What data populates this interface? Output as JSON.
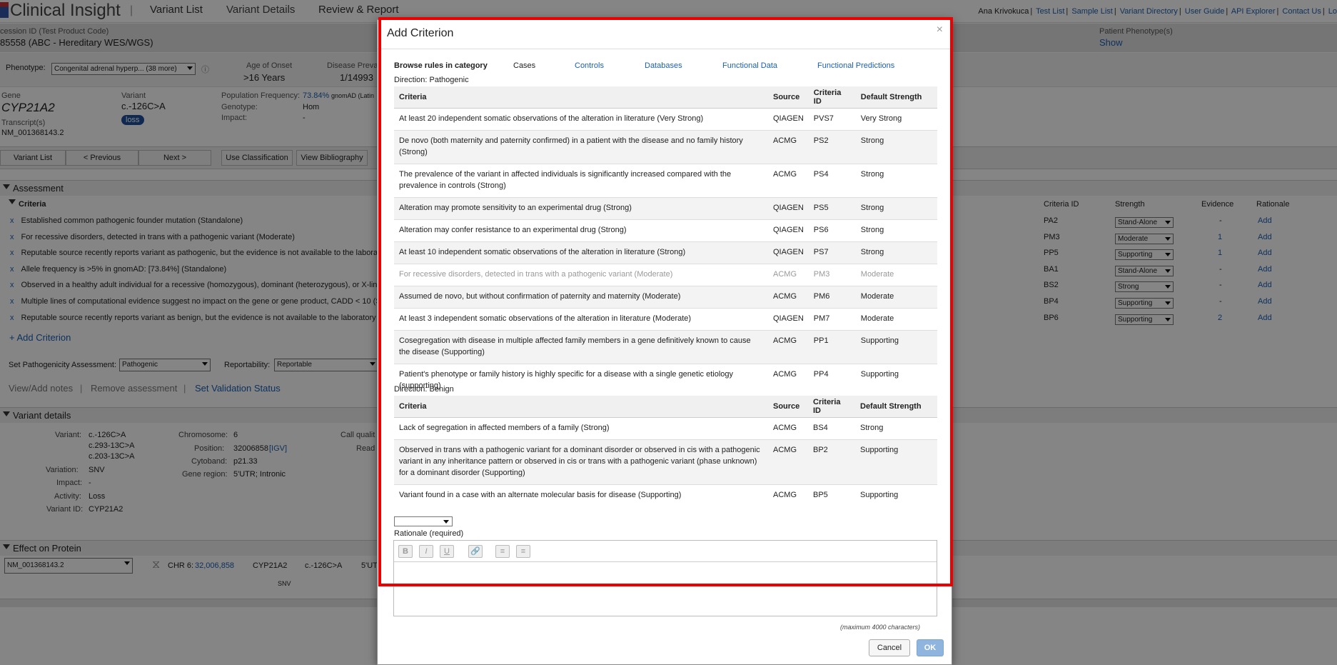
{
  "app": {
    "title": "Clinical Insight",
    "nav": [
      "Variant List",
      "Variant Details",
      "Review & Report"
    ],
    "user": "Ana Krivokuca",
    "links": [
      "Test List",
      "Sample List",
      "Variant Directory",
      "User Guide",
      "API Explorer",
      "Contact Us",
      "Lo"
    ]
  },
  "header": {
    "accession_label": "cession ID (Test Product Code)",
    "accession_value": "85558  (ABC - Hereditary WES/WGS)",
    "patient_pheno_label": "Patient Phenotype(s)",
    "patient_pheno_link": "Show"
  },
  "pheno_row": {
    "label": "Phenotype:",
    "value": "Congenital adrenal hyperp... (38 more)",
    "onset_label": "Age of Onset",
    "onset_value": ">16 Years",
    "prev_label": "Disease Preva",
    "prev_value": "1/14993"
  },
  "gene": {
    "gene_label": "Gene",
    "gene_value": "CYP21A2",
    "transcript_label": "Transcript(s)",
    "transcript_value": "NM_001368143.2",
    "variant_label": "Variant",
    "variant_value": "c.-126C>A",
    "badge": "loss",
    "popfreq_label": "Population Frequency:",
    "popfreq_value": "73.84%",
    "popfreq_src": "gnomAD (Latin",
    "genotype_label": "Genotype:",
    "genotype_value": "Hom",
    "impact_label": "Impact:",
    "impact_value": "-"
  },
  "buttons": [
    "Variant List",
    "< Previous",
    "Next >",
    "Use Classification",
    "View Bibliography"
  ],
  "assessment": {
    "title": "Assessment",
    "criteria_title": "Criteria",
    "cols": [
      "Criteria ID",
      "Strength",
      "Evidence",
      "Rationale"
    ],
    "rows": [
      {
        "text": "Established common pathogenic founder mutation (Standalone)",
        "id": "PA2",
        "strength": "Stand-Alone",
        "evidence": "-",
        "rationale": "Add"
      },
      {
        "text": "For recessive disorders, detected in trans with a pathogenic variant (Moderate)",
        "id": "PM3",
        "strength": "Moderate",
        "evidence": "1",
        "rationale": "Add"
      },
      {
        "text": "Reputable source recently reports variant as pathogenic, but the evidence is not available to the laborat",
        "id": "PP5",
        "strength": "Supporting",
        "evidence": "1",
        "rationale": "Add"
      },
      {
        "text": "Allele frequency is >5% in gnomAD: [73.84%] (Standalone)",
        "id": "BA1",
        "strength": "Stand-Alone",
        "evidence": "-",
        "rationale": "Add"
      },
      {
        "text": "Observed in a healthy adult individual for a recessive (homozygous), dominant (heterozygous), or X-link",
        "id": "BS2",
        "strength": "Strong",
        "evidence": "-",
        "rationale": "Add"
      },
      {
        "text": "Multiple lines of computational evidence suggest no impact on the gene or gene product, CADD < 10 (S",
        "id": "BP4",
        "strength": "Supporting",
        "evidence": "-",
        "rationale": "Add"
      },
      {
        "text": "Reputable source recently reports variant as benign, but the evidence is not available to the laboratory t",
        "id": "BP6",
        "strength": "Supporting",
        "evidence": "2",
        "rationale": "Add"
      }
    ],
    "add_criterion": "+ Add Criterion",
    "set_patho_label": "Set Pathogenicity Assessment:",
    "set_patho_value": "Pathogenic",
    "report_label": "Reportability:",
    "report_value": "Reportable",
    "notes": "View/Add notes",
    "remove": "Remove assessment",
    "validation": "Set Validation Status"
  },
  "variant_details": {
    "title": "Variant details",
    "variant_label": "Variant:",
    "variant_values": [
      "c.-126C>A",
      "c.293-13C>A",
      "c.203-13C>A"
    ],
    "variation_label": "Variation:",
    "variation_value": "SNV",
    "impact_label": "Impact:",
    "impact_value": "-",
    "activity_label": "Activity:",
    "activity_value": "Loss",
    "vid_label": "Variant ID:",
    "vid_value": "CYP21A2",
    "chrom_label": "Chromosome:",
    "chrom_value": "6",
    "pos_label": "Position:",
    "pos_value": "32006858",
    "igv": "[IGV]",
    "cyto_label": "Cytoband:",
    "cyto_value": "p21.33",
    "region_label": "Gene region:",
    "region_value": "5'UTR; Intronic",
    "callq": "Call qualit",
    "read": "Read"
  },
  "effect": {
    "title": "Effect on Protein",
    "transcript": "NM_001368143.2",
    "chr_label": "CHR 6:",
    "chr_value": "32,006,858",
    "gene": "CYP21A2",
    "variant": "c.-126C>A",
    "region": "5'UT",
    "snv": "SNV"
  },
  "dialog": {
    "title": "Add Criterion",
    "close": "×",
    "browse_label": "Browse rules in category",
    "categories": [
      "Cases",
      "Controls",
      "Databases",
      "Functional Data",
      "Functional Predictions"
    ],
    "pathogenic_label": "Direction: ",
    "pathogenic_dir": "Pathogenic",
    "benign_label": "Direction: ",
    "benign_dir": "Benign",
    "headers": [
      "Criteria",
      "Source",
      "Criteria ID",
      "Default Strength"
    ],
    "pathogenic": [
      {
        "c": "At least 20 independent somatic observations of the alteration in literature (Very Strong)",
        "s": "QIAGEN",
        "id": "PVS7",
        "st": "Very Strong"
      },
      {
        "c": "De novo (both maternity and paternity confirmed) in a patient with the disease and no family history (Strong)",
        "s": "ACMG",
        "id": "PS2",
        "st": "Strong"
      },
      {
        "c": "The prevalence of the variant in affected individuals is significantly increased compared with the prevalence in controls (Strong)",
        "s": "ACMG",
        "id": "PS4",
        "st": "Strong"
      },
      {
        "c": "Alteration may promote sensitivity to an experimental drug (Strong)",
        "s": "QIAGEN",
        "id": "PS5",
        "st": "Strong"
      },
      {
        "c": "Alteration may confer resistance to an experimental drug (Strong)",
        "s": "QIAGEN",
        "id": "PS6",
        "st": "Strong"
      },
      {
        "c": "At least 10 independent somatic observations of the alteration in literature (Strong)",
        "s": "QIAGEN",
        "id": "PS7",
        "st": "Strong"
      },
      {
        "c": "For recessive disorders, detected in trans with a pathogenic variant (Moderate)",
        "s": "ACMG",
        "id": "PM3",
        "st": "Moderate"
      },
      {
        "c": "Assumed de novo, but without confirmation of paternity and maternity (Moderate)",
        "s": "ACMG",
        "id": "PM6",
        "st": "Moderate"
      },
      {
        "c": "At least 3 independent somatic observations of the alteration in literature (Moderate)",
        "s": "QIAGEN",
        "id": "PM7",
        "st": "Moderate"
      },
      {
        "c": "Cosegregation with disease in multiple affected family members in a gene definitively known to cause the disease (Supporting)",
        "s": "ACMG",
        "id": "PP1",
        "st": "Supporting"
      },
      {
        "c": "Patient's phenotype or family history is highly specific for a disease with a single genetic etiology (supporting)",
        "s": "ACMG",
        "id": "PP4",
        "st": "Supporting"
      }
    ],
    "benign": [
      {
        "c": "Lack of segregation in affected members of a family (Strong)",
        "s": "ACMG",
        "id": "BS4",
        "st": "Strong"
      },
      {
        "c": "Observed in trans with a pathogenic variant for a dominant disorder or observed in cis with a pathogenic variant in any inheritance pattern or observed in cis or trans with a pathogenic variant (phase unknown) for a dominant disorder (Supporting)",
        "s": "ACMG",
        "id": "BP2",
        "st": "Supporting"
      },
      {
        "c": "Variant found in a case with an alternate molecular basis for disease (Supporting)",
        "s": "ACMG",
        "id": "BP5",
        "st": "Supporting"
      }
    ],
    "rationale_label": "Rationale (required)",
    "toolbar": [
      "B",
      "I",
      "U",
      "🔗",
      "≡",
      "≡"
    ],
    "max_chars": "(maximum 4000 characters)",
    "cancel": "Cancel",
    "ok": "OK"
  }
}
